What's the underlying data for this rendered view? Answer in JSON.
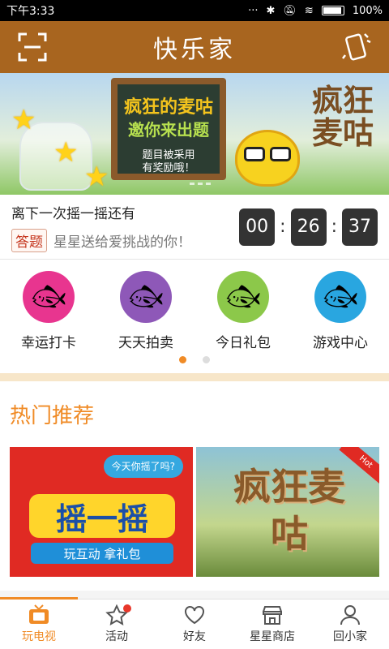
{
  "status": {
    "time": "下午3:33",
    "battery": "100%"
  },
  "header": {
    "title": "快乐家"
  },
  "banner": {
    "line1": "疯狂的麦咕",
    "line2": "邀你来出题",
    "line3": "题目被采用",
    "line4": "有奖励哦！",
    "logo_text": "疯狂麦咕"
  },
  "countdown": {
    "label": "离下一次摇一摇还有",
    "tag": "答题",
    "subtitle": "星星送给爱挑战的你！",
    "hours": "00",
    "minutes": "26",
    "seconds": "37",
    "sep": ":"
  },
  "features": [
    {
      "label": "幸运打卡",
      "color": "#e8358f"
    },
    {
      "label": "天天拍卖",
      "color": "#8e58b8"
    },
    {
      "label": "今日礼包",
      "color": "#8cc84a"
    },
    {
      "label": "游戏中心",
      "color": "#29a6e0"
    }
  ],
  "hot": {
    "title": "热门推荐",
    "card1": {
      "bubble": "今天你摇了吗?",
      "main": "摇一摇",
      "sub": "玩互动 拿礼包"
    },
    "card2": {
      "ribbon": "Hot",
      "logo": "疯狂麦咕"
    }
  },
  "tabs": [
    {
      "label": "玩电视",
      "icon": "tv-icon",
      "active": true
    },
    {
      "label": "活动",
      "icon": "star-icon",
      "badge": true
    },
    {
      "label": "好友",
      "icon": "heart-icon"
    },
    {
      "label": "星星商店",
      "icon": "store-icon"
    },
    {
      "label": "回小家",
      "icon": "person-icon"
    }
  ],
  "colors": {
    "brand": "#a8651f",
    "accent": "#f08b26",
    "countdown_bg": "#333333"
  }
}
